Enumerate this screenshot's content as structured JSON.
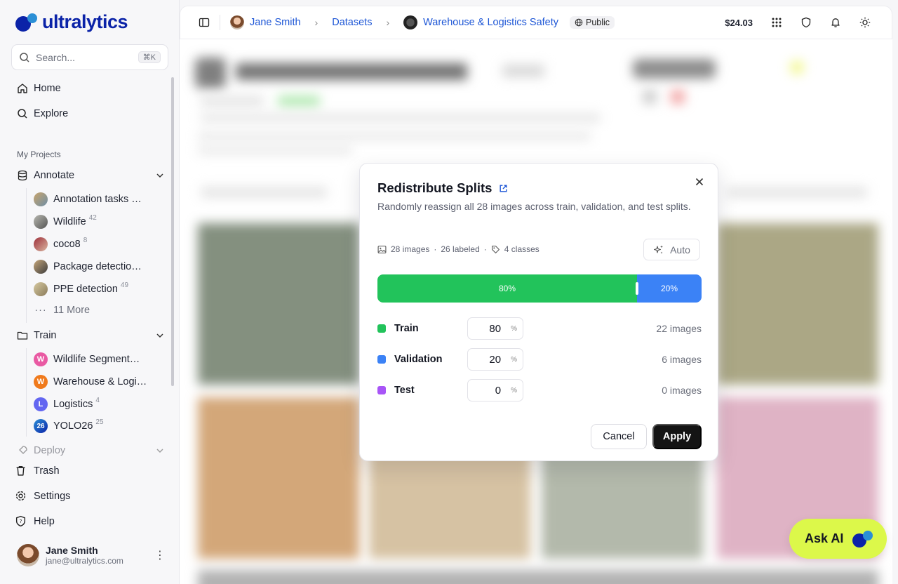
{
  "brand": {
    "name": "ultralytics"
  },
  "search": {
    "placeholder": "Search...",
    "shortcut": "⌘K"
  },
  "nav": {
    "home": "Home",
    "explore": "Explore"
  },
  "projects": {
    "title": "My Projects",
    "annotate": {
      "label": "Annotate",
      "items": [
        {
          "label": "Annotation tasks …",
          "count": ""
        },
        {
          "label": "Wildlife",
          "count": "42"
        },
        {
          "label": "coco8",
          "count": "8"
        },
        {
          "label": "Package detectio…",
          "count": ""
        },
        {
          "label": "PPE detection",
          "count": "49"
        }
      ],
      "more": "11 More"
    },
    "train": {
      "label": "Train",
      "items": [
        {
          "letter": "W",
          "label": "Wildlife Segment…",
          "count": "",
          "color": "#e95aa3"
        },
        {
          "letter": "W",
          "label": "Warehouse & Logi…",
          "count": "",
          "color": "#f07a1c"
        },
        {
          "letter": "L",
          "label": "Logistics",
          "count": "4",
          "color": "#6366f1"
        },
        {
          "letter": "26",
          "label": "YOLO26",
          "count": "25",
          "color": "#2b8fd6"
        }
      ]
    },
    "deploy": {
      "label": "Deploy"
    }
  },
  "bottom_nav": {
    "trash": "Trash",
    "settings": "Settings",
    "help": "Help"
  },
  "user": {
    "name": "Jane Smith",
    "email": "jane@ultralytics.com"
  },
  "topbar": {
    "user": "Jane Smith",
    "datasets": "Datasets",
    "dataset": "Warehouse & Logistics Safety",
    "visibility": "Public",
    "credit": "$24.03"
  },
  "modal": {
    "title": "Redistribute Splits",
    "description": "Randomly reassign all 28 images across train, validation, and test splits.",
    "images": "28 images",
    "labeled": "26 labeled",
    "classes": "4 classes",
    "auto_label": "Auto",
    "bar": {
      "train_label": "80%",
      "val_label": "20%",
      "train_fraction": 0.8,
      "val_fraction": 0.2
    },
    "splits": [
      {
        "label": "Train",
        "value": "80",
        "count": "22 images",
        "color": "#22c35b"
      },
      {
        "label": "Validation",
        "value": "20",
        "count": "6 images",
        "color": "#3b82f6"
      },
      {
        "label": "Test",
        "value": "0",
        "count": "0 images",
        "color": "#a855f7"
      }
    ],
    "percent_symbol": "%",
    "cancel": "Cancel",
    "apply": "Apply"
  },
  "ask_ai": "Ask AI"
}
